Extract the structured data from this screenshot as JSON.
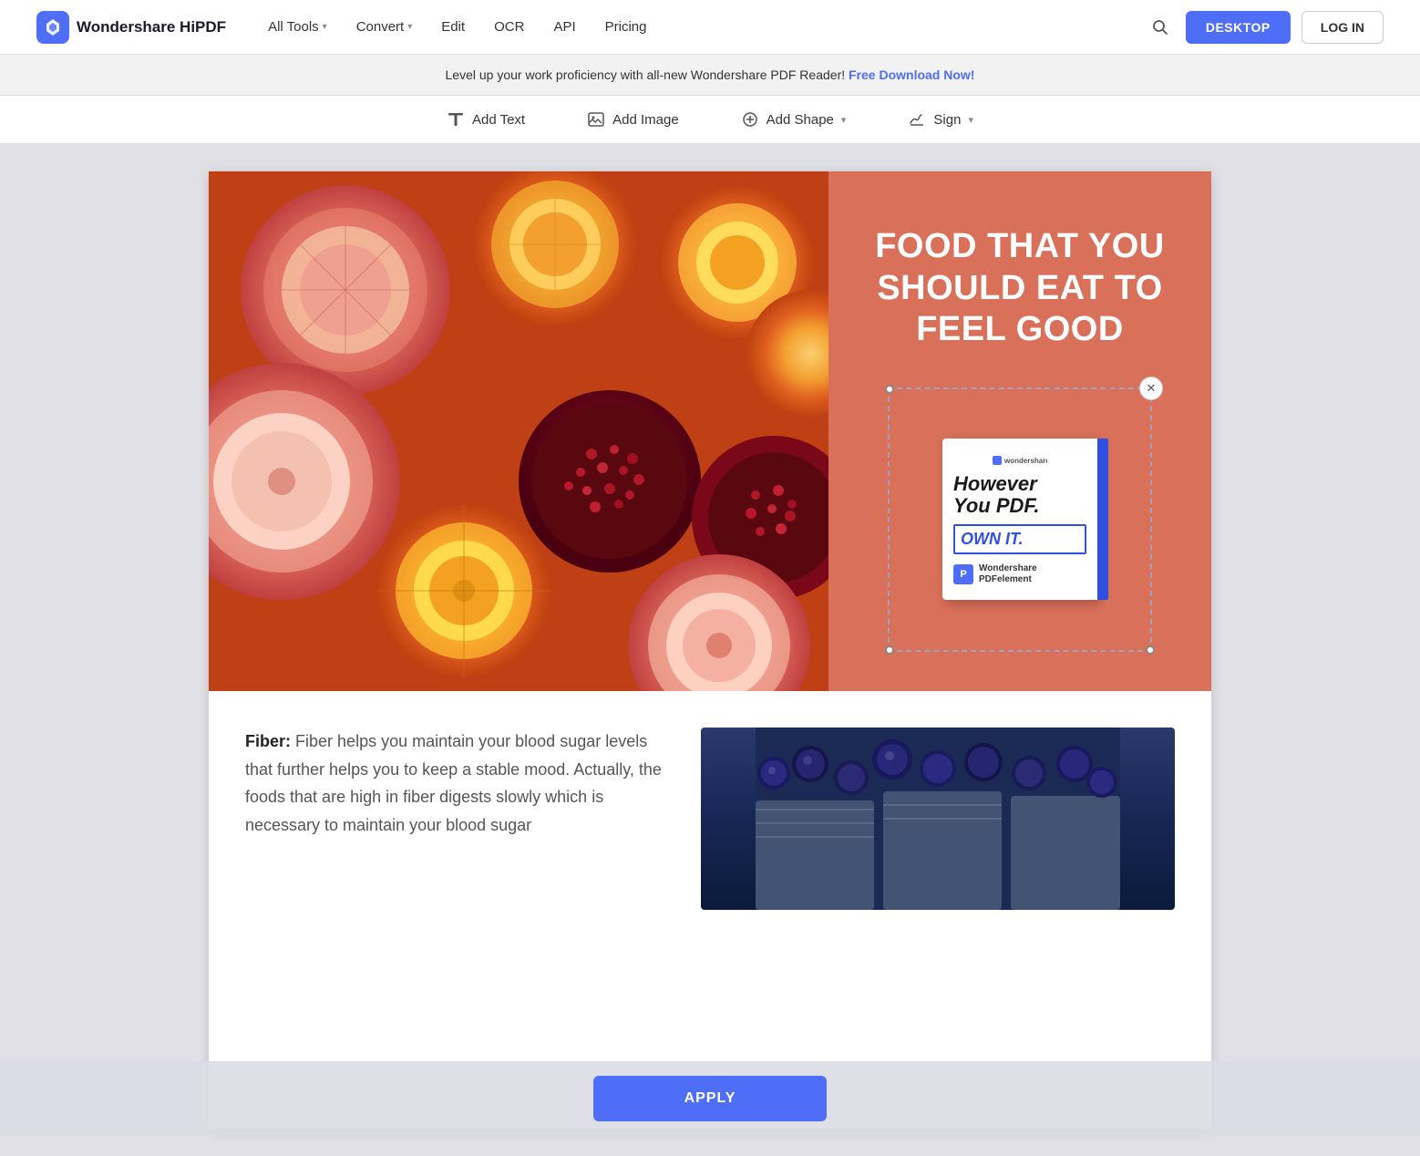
{
  "nav": {
    "logo_text": "Wondershare HiPDF",
    "links": [
      {
        "label": "All Tools",
        "has_dropdown": true
      },
      {
        "label": "Convert",
        "has_dropdown": true
      },
      {
        "label": "Edit",
        "has_dropdown": false
      },
      {
        "label": "OCR",
        "has_dropdown": false
      },
      {
        "label": "API",
        "has_dropdown": false
      },
      {
        "label": "Pricing",
        "has_dropdown": false
      }
    ],
    "btn_desktop": "DESKTOP",
    "btn_login": "LOG IN"
  },
  "banner": {
    "text": "Level up your work proficiency with all-new Wondershare PDF Reader!",
    "link_text": "Free Download Now!"
  },
  "toolbar": {
    "items": [
      {
        "label": "Add Text",
        "icon": "text-icon"
      },
      {
        "label": "Add Image",
        "icon": "image-icon"
      },
      {
        "label": "Add Shape",
        "icon": "shape-icon",
        "has_dropdown": true
      },
      {
        "label": "Sign",
        "icon": "sign-icon",
        "has_dropdown": true
      }
    ]
  },
  "page_content": {
    "hero_title": "FOOD THAT YOU SHOULD EAT TO FEEL GOOD",
    "book": {
      "logo": "wondershare",
      "title_line1": "However",
      "title_line2": "You PDF.",
      "subtitle": "OWN IT.",
      "brand_name_line1": "Wondershare",
      "brand_name_line2": "PDFelement"
    },
    "fiber_text": {
      "label": "Fiber:",
      "body": " Fiber helps you maintain your blood sugar levels that further helps you to keep a stable mood. Actually, the foods that are high in fiber digests slowly which is necessary to maintain your blood sugar"
    }
  },
  "apply_button": {
    "label": "APPLY"
  }
}
